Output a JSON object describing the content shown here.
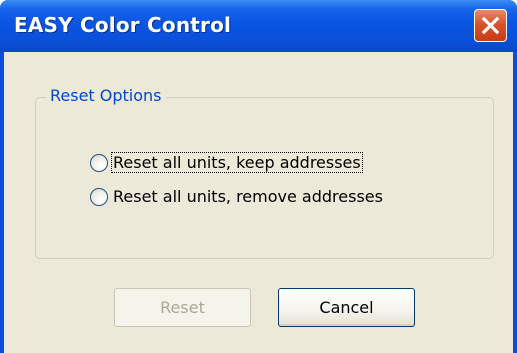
{
  "window": {
    "title": "EASY Color Control",
    "close_icon": "close-icon"
  },
  "reset_options": {
    "group_label": "Reset Options",
    "options": [
      {
        "label": "Reset all units, keep addresses",
        "selected": false,
        "focused": true
      },
      {
        "label": "Reset all units, remove addresses",
        "selected": false,
        "focused": false
      }
    ]
  },
  "buttons": {
    "reset_label": "Reset",
    "reset_enabled": false,
    "cancel_label": "Cancel"
  },
  "colors": {
    "titlebar": "#0a4fd8",
    "client_background": "#ece9d8",
    "group_label": "#0046d5",
    "close_button": "#d9532e",
    "disabled_text": "#aca899"
  }
}
